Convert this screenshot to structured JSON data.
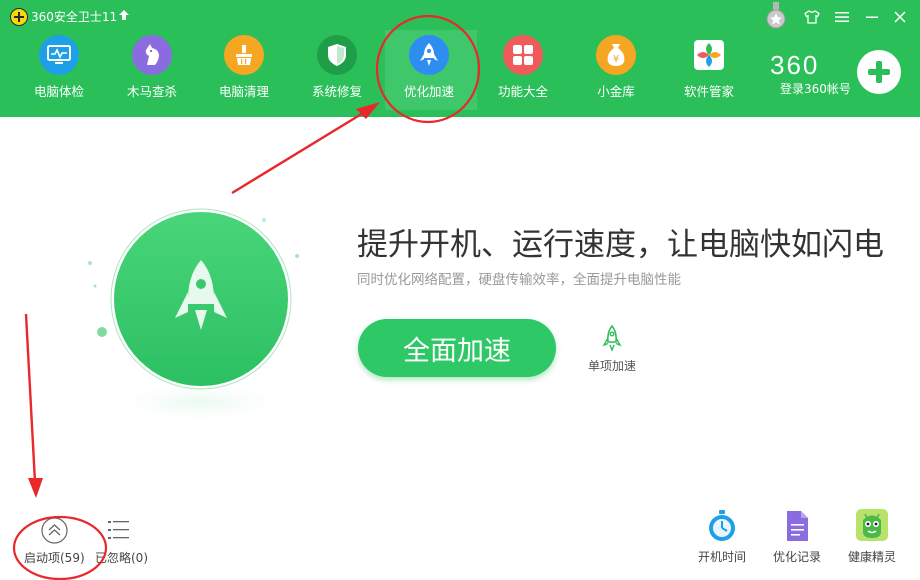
{
  "app": {
    "title": "360安全卫士11"
  },
  "nav": {
    "items": [
      {
        "label": "电脑体检",
        "icon": "monitor-checkup-icon",
        "color": "#1ea0e8"
      },
      {
        "label": "木马查杀",
        "icon": "horse-icon",
        "color": "#8a6be0"
      },
      {
        "label": "电脑清理",
        "icon": "broom-icon",
        "color": "#f5a623"
      },
      {
        "label": "系统修复",
        "icon": "shield-icon",
        "color": "#1f9e4a"
      },
      {
        "label": "优化加速",
        "icon": "rocket-icon",
        "color": "#2d8df0",
        "active": true
      },
      {
        "label": "功能大全",
        "icon": "grid-icon",
        "color": "#f05a5a"
      },
      {
        "label": "小金库",
        "icon": "money-bag-icon",
        "color": "#f5a623"
      },
      {
        "label": "软件管家",
        "icon": "software-icon",
        "color": "#2bbf59"
      }
    ],
    "brand": "360",
    "login_label": "登录360帐号"
  },
  "main": {
    "headline": "提升开机、运行速度，让电脑快如闪电",
    "subline": "同时优化网络配置，硬盘传输效率，全面提升电脑性能",
    "accelerate_button": "全面加速",
    "single_accelerate": "单项加速"
  },
  "bottom": {
    "startup_items": "启动项(59)",
    "ignored": "已忽略(0)",
    "tools": [
      {
        "label": "开机时间",
        "icon": "stopwatch-icon"
      },
      {
        "label": "优化记录",
        "icon": "document-icon"
      },
      {
        "label": "健康精灵",
        "icon": "android-sprite-icon"
      }
    ]
  },
  "colors": {
    "brand_green": "#2bbf59",
    "button_green": "#2ec866",
    "annotation_red": "#e8282b"
  }
}
